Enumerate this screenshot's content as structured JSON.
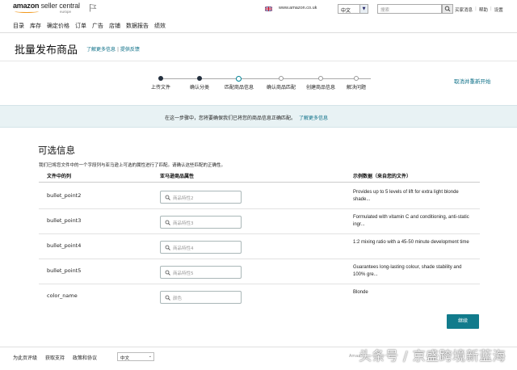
{
  "header": {
    "logo_text": "amazon seller central",
    "logo_sub": "europe",
    "site": "www.amazon.co.uk",
    "language": "中文",
    "search_placeholder": "搜索",
    "links": [
      "买家消息",
      "帮助",
      "设置"
    ]
  },
  "nav": [
    "目录",
    "库存",
    "确定价格",
    "订单",
    "广告",
    "店铺",
    "数据报告",
    "绩效"
  ],
  "page": {
    "title": "批量发布商品",
    "learn_more": "了解更多信息",
    "feedback": "提供反馈",
    "link_separator": "|"
  },
  "steps": [
    {
      "label": "上传文件",
      "state": "done"
    },
    {
      "label": "确认分类",
      "state": "done"
    },
    {
      "label": "匹配商品信息",
      "state": "current"
    },
    {
      "label": "确认商品匹配",
      "state": "todo"
    },
    {
      "label": "创建商品信息",
      "state": "todo"
    },
    {
      "label": "解决问题",
      "state": "todo"
    }
  ],
  "cancel": "取消并重新开始",
  "banner": {
    "text": "在这一步骤中，您将要确保我们已将您的商品信息正确匹配。",
    "link": "了解更多信息"
  },
  "section": {
    "title": "可选信息",
    "description": "我们已将您文件中的一个字段列与亚马逊上可选的属性进行了匹配。请确认这些匹配的正确性。",
    "col_file": "文件中的列",
    "col_attr": "亚马逊商品属性",
    "col_sample": "示例数据（来自您的文件）"
  },
  "rows": [
    {
      "field": "bullet_point2",
      "attr": "商品特性2",
      "sample": "Provides up to 5 levels of lift for extra light blonde shade..."
    },
    {
      "field": "bullet_point3",
      "attr": "商品特性3",
      "sample": "Formulated with vitamin C and conditioning, anti-static ingr..."
    },
    {
      "field": "bullet_point4",
      "attr": "商品特性4",
      "sample": "1:2 mixing ratio with a 45-50 minute development time"
    },
    {
      "field": "bullet_point5",
      "attr": "商品特性5",
      "sample": "Guarantees long-lasting colour, shade stability and 100% gre..."
    },
    {
      "field": "color_name",
      "attr": "颜色",
      "sample": "Blonde"
    }
  ],
  "continue": "继续",
  "footer": {
    "links": [
      "为此页评级",
      "获取支持",
      "政策和协议"
    ],
    "language": "中文",
    "right": "Amaz"
  },
  "watermark": "头条号 / 京盛跨境新蓝海",
  "colors": {
    "accent": "#0a6e86",
    "button": "#117b8c",
    "banner_bg": "#e8f2f4"
  }
}
